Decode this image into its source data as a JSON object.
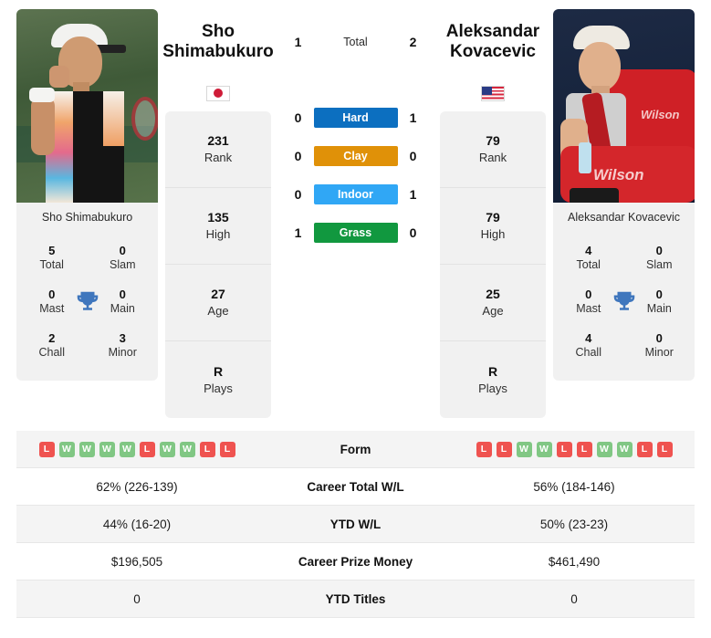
{
  "players": {
    "left": {
      "name": "Sho Shimabukuro",
      "name_line1": "Sho",
      "name_line2": "Shimabukuro",
      "flag": "jp-flag-icon",
      "stats": [
        {
          "value": "231",
          "label": "Rank"
        },
        {
          "value": "135",
          "label": "High"
        },
        {
          "value": "27",
          "label": "Age"
        },
        {
          "value": "R",
          "label": "Plays"
        }
      ],
      "titles": [
        {
          "value": "5",
          "label": "Total"
        },
        {
          "value": "0",
          "label": "Slam"
        },
        {
          "value": "0",
          "label": "Mast"
        },
        {
          "value": "0",
          "label": "Main"
        },
        {
          "value": "2",
          "label": "Chall"
        },
        {
          "value": "3",
          "label": "Minor"
        }
      ],
      "form": [
        "L",
        "W",
        "W",
        "W",
        "W",
        "L",
        "W",
        "W",
        "L",
        "L"
      ],
      "career_wl": "62% (226-139)",
      "ytd_wl": "44% (16-20)",
      "prize_money": "$196,505",
      "ytd_titles": "0"
    },
    "right": {
      "name": "Aleksandar Kovacevic",
      "name_line1": "Aleksandar",
      "name_line2": "Kovacevic",
      "flag": "us-flag-icon",
      "stats": [
        {
          "value": "79",
          "label": "Rank"
        },
        {
          "value": "79",
          "label": "High"
        },
        {
          "value": "25",
          "label": "Age"
        },
        {
          "value": "R",
          "label": "Plays"
        }
      ],
      "titles": [
        {
          "value": "4",
          "label": "Total"
        },
        {
          "value": "0",
          "label": "Slam"
        },
        {
          "value": "0",
          "label": "Mast"
        },
        {
          "value": "0",
          "label": "Main"
        },
        {
          "value": "4",
          "label": "Chall"
        },
        {
          "value": "0",
          "label": "Minor"
        }
      ],
      "form": [
        "L",
        "L",
        "W",
        "W",
        "L",
        "L",
        "W",
        "W",
        "L",
        "L"
      ],
      "career_wl": "56% (184-146)",
      "ytd_wl": "50% (23-23)",
      "prize_money": "$461,490",
      "ytd_titles": "0"
    }
  },
  "h2h": {
    "total": {
      "label": "Total",
      "left": "1",
      "right": "2"
    },
    "surfaces": [
      {
        "label": "Hard",
        "left": "0",
        "right": "1",
        "color": "#0c6fc0"
      },
      {
        "label": "Clay",
        "left": "0",
        "right": "0",
        "color": "#e09108"
      },
      {
        "label": "Indoor",
        "left": "0",
        "right": "1",
        "color": "#30a7f5"
      },
      {
        "label": "Grass",
        "left": "1",
        "right": "0",
        "color": "#11983f"
      }
    ]
  },
  "table": {
    "rows": [
      {
        "label": "Form"
      },
      {
        "label": "Career Total W/L"
      },
      {
        "label": "YTD W/L"
      },
      {
        "label": "Career Prize Money"
      },
      {
        "label": "YTD Titles"
      }
    ]
  },
  "colors": {
    "win": "#81c784",
    "loss": "#ef5350",
    "trophy": "#3f76bd",
    "card_bg": "#f1f1f1",
    "row_alt": "#f4f4f4"
  }
}
